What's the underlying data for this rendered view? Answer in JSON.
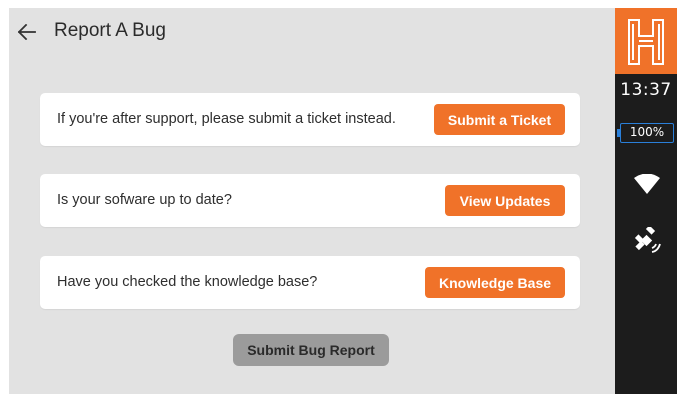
{
  "header": {
    "title": "Report A Bug",
    "back_icon": "arrow-left-icon"
  },
  "cards": [
    {
      "message": "If you're after support, please submit a ticket instead.",
      "button_label": "Submit a Ticket"
    },
    {
      "message": "Is your sofware up to date?",
      "button_label": "View Updates"
    },
    {
      "message": "Have you checked the knowledge base?",
      "button_label": "Knowledge Base"
    }
  ],
  "submit_label": "Submit Bug Report",
  "status_bar": {
    "logo_icon": "h-brand-logo",
    "time": "13:37",
    "battery": "100%",
    "wifi_icon": "wifi-icon",
    "gps_icon": "satellite-icon"
  },
  "colors": {
    "accent": "#f07229",
    "background": "#e2e2e2",
    "card": "#ffffff",
    "sidebar": "#1c1c1c",
    "battery_border": "#2a7fd9",
    "disabled_button": "#9b9b9b"
  }
}
